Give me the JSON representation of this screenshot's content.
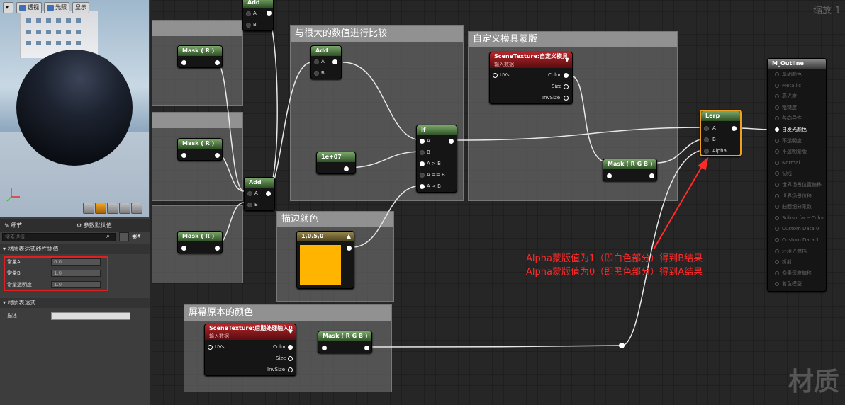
{
  "viewport_toolbar": {
    "perspective": "透视",
    "lit": "光照",
    "show": "显示"
  },
  "panel_tabs": {
    "details": "细节",
    "defaults": "参数默认值"
  },
  "search": {
    "placeholder": "搜索详情"
  },
  "lerp_section": {
    "title": "材质表达式线性插值",
    "rows": [
      {
        "label": "常量A",
        "value": "0.0"
      },
      {
        "label": "常量B",
        "value": "1.0"
      },
      {
        "label": "常量透明度",
        "value": "1.0"
      }
    ]
  },
  "expr_section": {
    "title": "材质表达式",
    "desc_label": "描述"
  },
  "graph": {
    "zoom": "缩放-1",
    "watermark": "材质",
    "comments": {
      "compare": "与很大的数值进行比较",
      "custom_mask": "自定义模具蒙版",
      "outline_color": "描边颜色",
      "screen_color": "屏幕原本的颜色"
    },
    "nodes": {
      "add": "Add",
      "mask_r": "Mask ( R )",
      "if": "If",
      "const_big": "1e+07",
      "color_const": "1,0.5,0",
      "scenetex_custom": "SceneTexture:自定义模具",
      "scenetex_post": "SceneTexture:后期处理输入0",
      "input_data": "输入数据",
      "mask_rgb": "Mask ( R G B )",
      "lerp": "Lerp",
      "output": "M_Outline"
    },
    "pins": {
      "a": "A",
      "b": "B",
      "alpha": "Alpha",
      "a_gt_b": "A > B",
      "a_eq_b": "A == B",
      "a_lt_b": "A < B",
      "uvs": "UVs",
      "color": "Color",
      "size": "Size",
      "invsize": "InvSize"
    },
    "output_pins": [
      "基础颜色",
      "Metallic",
      "高光度",
      "粗糙度",
      "各向异性",
      "自发光颜色",
      "不透明度",
      "不透明蒙版",
      "Normal",
      "切线",
      "世界场景位置偏移",
      "世界场景位移",
      "曲面细分乘数",
      "Subsurface Color",
      "Custom Data 0",
      "Custom Data 1",
      "环境光遮挡",
      "折射",
      "像素深度偏移",
      "着色模型"
    ],
    "active_output": 5,
    "annotation": {
      "line1": "Alpha蒙版值为1（即白色部分）得到B结果",
      "line2": "Alpha蒙版值为0（即黑色部分）得到A结果"
    }
  },
  "colors": {
    "accent_orange": "#ffb400",
    "annotation_red": "#ff2a2a",
    "lerp_border": "#f0a020"
  }
}
